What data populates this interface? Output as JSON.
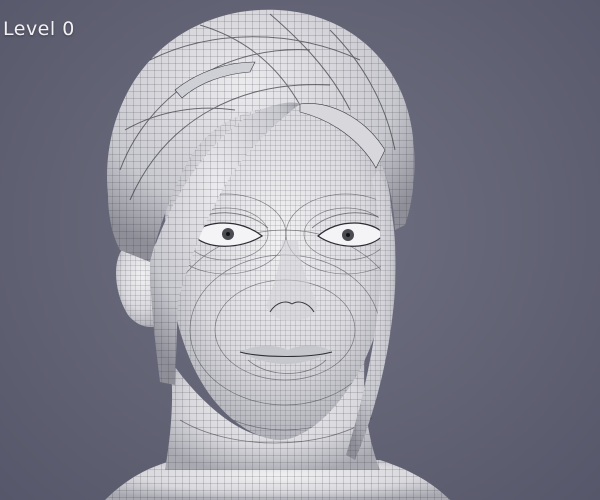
{
  "viewport": {
    "level_label": "Level 0",
    "background_color": "#626374",
    "mesh_color": "#e4e4e8",
    "wire_color": "#2a2a30"
  },
  "model": {
    "icon": "wireframe-head-icon"
  }
}
